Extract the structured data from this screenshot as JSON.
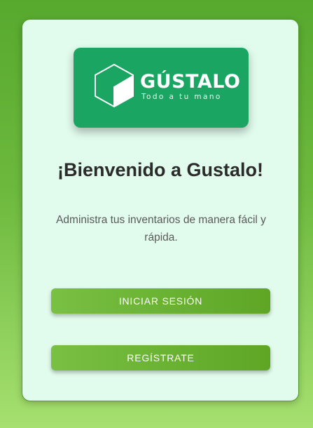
{
  "logo": {
    "name": "GÚSTALO",
    "tagline": "Todo a tu mano",
    "icon": "cube-icon"
  },
  "welcome": {
    "title": "¡Bienvenido a Gustalo!",
    "subtitle": "Administra tus inventarios de manera fácil y rápida."
  },
  "actions": {
    "login_label": "INICIAR SESIÓN",
    "register_label": "REGÍSTRATE"
  },
  "colors": {
    "background_top": "#57a92e",
    "background_bottom": "#a6e070",
    "card": "#e1fbec",
    "logo_box": "#1aa662",
    "button_start": "#79c043",
    "button_end": "#5ea624"
  }
}
